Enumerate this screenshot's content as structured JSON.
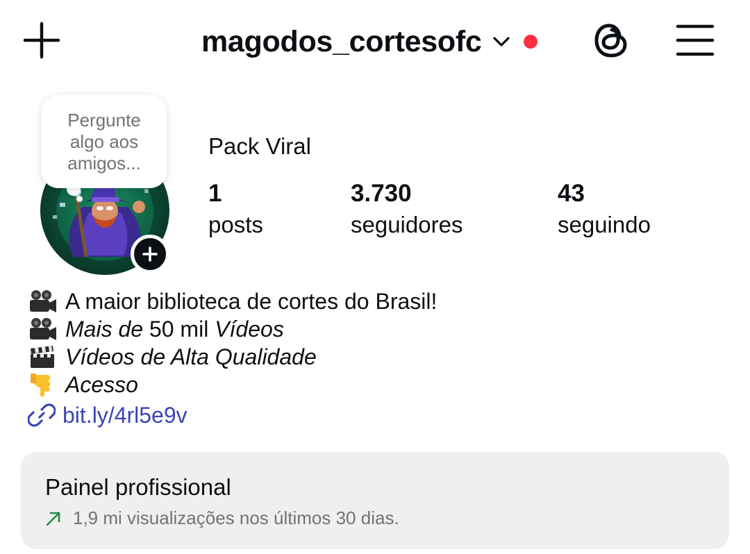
{
  "header": {
    "username": "magodos_cortesofc",
    "icons": {
      "create": "plus-icon",
      "account_switcher": "chevron-down-icon",
      "notification": "red-dot",
      "threads": "threads-icon",
      "menu": "hamburger-menu-icon"
    }
  },
  "profile": {
    "note_prompt": "Pergunte algo aos amigos...",
    "display_name": "Pack Viral",
    "stats": {
      "posts": {
        "value": "1",
        "label": "posts"
      },
      "followers": {
        "value": "3.730",
        "label": "seguidores"
      },
      "following": {
        "value": "43",
        "label": "seguindo"
      }
    }
  },
  "bio": {
    "line1": {
      "emoji": "🎥",
      "text": "A maior biblioteca de cortes do Brasil!"
    },
    "line2": {
      "emoji": "🎥",
      "italic_a": "Mais de",
      "plain": " 50 mil ",
      "italic_b": "Vídeos"
    },
    "line3": {
      "emoji": "🎬",
      "italic": "Vídeos de Alta Qualidade"
    },
    "line4": {
      "emoji": "👇",
      "italic": "Acesso"
    },
    "link": "bit.ly/4rl5e9v"
  },
  "dashboard": {
    "title": "Painel profissional",
    "subtitle": "1,9 mi visualizações nos últimos 30 dias."
  },
  "colors": {
    "accent_link": "#3a45b4",
    "notification_dot": "#ff3040",
    "trend_green": "#1e8a4a",
    "dashboard_bg": "#efefef",
    "muted_text": "#737373"
  }
}
